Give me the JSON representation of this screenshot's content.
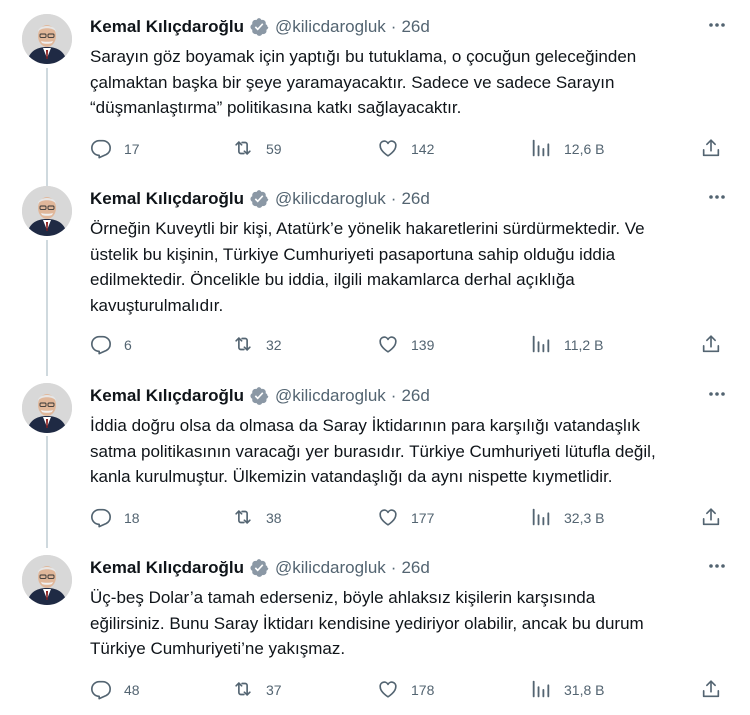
{
  "thread": {
    "tweets": [
      {
        "author_name": "Kemal Kılıçdaroğlu",
        "handle": "@kilicdarogluk",
        "separator": "·",
        "time": "26d",
        "lines": [
          "Sarayın göz boyamak için yaptığı bu tutuklama, o çocuğun geleceğinden",
          "çalmaktan başka bir şeye yaramayacaktır. Sadece ve sadece Sarayın",
          "“düşmanlaştırma” politikasına katkı sağlayacaktır."
        ],
        "replies": "17",
        "retweets": "59",
        "likes": "142",
        "views": "12,6 B"
      },
      {
        "author_name": "Kemal Kılıçdaroğlu",
        "handle": "@kilicdarogluk",
        "separator": "·",
        "time": "26d",
        "lines": [
          "Örneğin Kuveytli bir kişi, Atatürk’e yönelik hakaretlerini sürdürmektedir. Ve",
          "üstelik bu kişinin, Türkiye Cumhuriyeti pasaportuna sahip olduğu iddia",
          "edilmektedir. Öncelikle bu iddia, ilgili makamlarca derhal açıklığa",
          "kavuşturulmalıdır."
        ],
        "replies": "6",
        "retweets": "32",
        "likes": "139",
        "views": "11,2 B"
      },
      {
        "author_name": "Kemal Kılıçdaroğlu",
        "handle": "@kilicdarogluk",
        "separator": "·",
        "time": "26d",
        "lines": [
          "İddia doğru olsa da olmasa da Saray İktidarının para karşılığı vatandaşlık",
          "satma politikasının varacağı yer burasıdır. Türkiye Cumhuriyeti lütufla değil,",
          "kanla kurulmuştur. Ülkemizin vatandaşlığı da aynı nispette kıymetlidir."
        ],
        "replies": "18",
        "retweets": "38",
        "likes": "177",
        "views": "32,3 B"
      },
      {
        "author_name": "Kemal Kılıçdaroğlu",
        "handle": "@kilicdarogluk",
        "separator": "·",
        "time": "26d",
        "lines": [
          "Üç-beş Dolar’a tamah ederseniz, böyle ahlaksız kişilerin karşısında",
          "eğilirsiniz. Bunu Saray İktidarı kendisine yediriyor olabilir, ancak bu durum",
          "Türkiye Cumhuriyeti’ne yakışmaz."
        ],
        "replies": "48",
        "retweets": "37",
        "likes": "178",
        "views": "31,8 B"
      }
    ]
  },
  "colors": {
    "text": "#0f1419",
    "secondary": "#536471",
    "verified": "#1d9bf0",
    "rail": "#cfd9de"
  },
  "icons": [
    "verified-badge-icon",
    "more-icon",
    "reply-icon",
    "retweet-icon",
    "like-icon",
    "views-icon",
    "share-icon"
  ]
}
